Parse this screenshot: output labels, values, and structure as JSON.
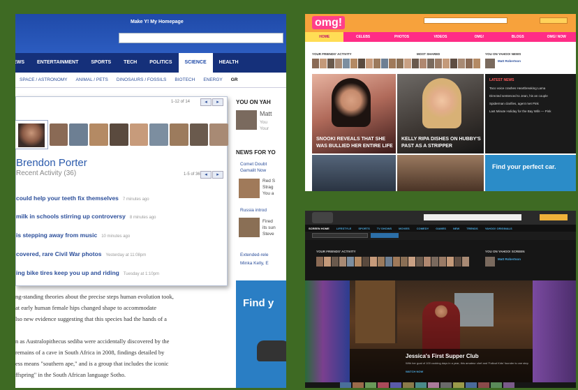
{
  "yahoo": {
    "header_title": "Make Y! My Homepage",
    "nav": [
      "NEWS",
      "ENTERTAINMENT",
      "SPORTS",
      "TECH",
      "POLITICS",
      "SCIENCE",
      "HEALTH"
    ],
    "subnav": [
      "SPACE / ASTRONOMY",
      "ANIMAL / PETS",
      "DINOSAURS / FOSSILS",
      "BIOTECH",
      "ENERGY",
      "GR"
    ],
    "friends_pager": "1-12 of 14",
    "profile_name": "Brendon Porter",
    "profile_activity": "Recent Activity (36)",
    "activity_pager": "1-5 of 36",
    "stories": [
      {
        "title": "could help your teeth fix themselves",
        "time": "7 minutes ago"
      },
      {
        "title": "milk in schools stirring up controversy",
        "time": "8 minutes ago"
      },
      {
        "title": "is stepping away from music",
        "time": "10 minutes ago"
      },
      {
        "title": "covered, rare Civil War photos",
        "time": "Yesterday at 11:08pm"
      },
      {
        "title": "ing bike tires keep you up and riding",
        "time": "Tuesday at 1:10pm"
      }
    ],
    "right_col": {
      "you_on": "YOU ON YAH",
      "you_name": "Matt",
      "you_sub1": "You",
      "you_sub2": "Your",
      "news_for": "NEWS FOR YO",
      "items": [
        "Comet Doubt",
        "Gamalit Now",
        "Red S",
        "Strag",
        "You a",
        "Russia introd",
        "Fired",
        "its sun",
        "Steve",
        "Extended-rele",
        "Minka Kelly, E"
      ]
    },
    "ad_text": "Find y",
    "article": [
      "ng-standing theories about the precise steps human evolution took,",
      "at early human female hips changed shape to accommodate",
      "lso new evidence suggesting that this species had the hands of a",
      "",
      "n as Australopithecus sediba were accidentally discovered by the",
      "remains of a cave in South Africa in 2008, findings detailed by",
      "ess means \"southern ape,\" and is a group that includes the iconic",
      "ffspring\" in the South African language Sotho."
    ]
  },
  "omg": {
    "logo": "omg!",
    "nav": [
      "HOME",
      "CELEBS",
      "PHOTOS",
      "VIDEOS",
      "OMG!",
      "BLOGS",
      "OMG! NOW"
    ],
    "friends_label": "YOUR FRIENDS' ACTIVITY",
    "most_shared": "MOST SHARED",
    "you_on": "YOU ON YAHOO! NEWS",
    "you_name": "Matt Robertson",
    "tile1": [
      "SNOOKI REVEALS THAT SHE",
      "WAS BULLIED HER ENTIRE LIFE"
    ],
    "tile2": [
      "KELLY RIPA DISHES ON HUBBY'S",
      "PAST AS A STRIPPER"
    ],
    "latest": "LATEST NEWS",
    "latest_items": [
      "Taco voice crashes Heartbreaking Lama",
      "Directed sentenced to Jean, his an couple",
      "Spiderman clarifies, agent met Pink",
      "Last Minute Holiday for the Bay Wife — Pink"
    ],
    "ad": "Find your perfect car."
  },
  "screen": {
    "nav": [
      "SCREEN HOME",
      "LIFESTYLE",
      "SPORTS",
      "TV SHOWS",
      "MOVIES",
      "COMEDY",
      "GAMES",
      "NEW",
      "TRENDS",
      "YAHOO! ORIGINALS"
    ],
    "friends_label": "YOUR FRIENDS' ACTIVITY",
    "you_on": "YOU ON YAHOO! SCREEN",
    "you_name": "Matt Robertson",
    "hero_title": "Jessica's First Supper Club",
    "hero_sub": "With her goal of 100 cooking days in a year, this amateur chef and 'Fallout Kids' founder is one step",
    "watch": "WATCH NOW"
  }
}
